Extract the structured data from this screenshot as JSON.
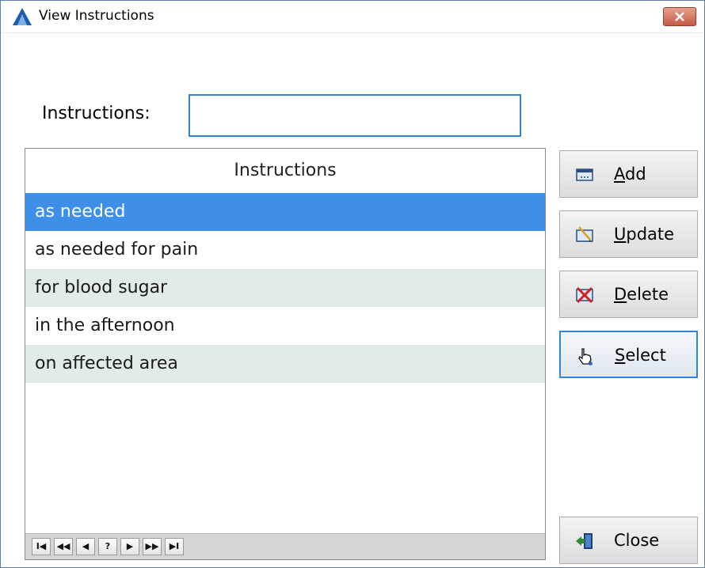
{
  "window": {
    "title": "View Instructions",
    "close_glyph": "✕"
  },
  "form": {
    "instructions_label": "Instructions:",
    "instructions_value": "",
    "instructions_placeholder": ""
  },
  "grid": {
    "header": "Instructions",
    "rows": [
      "as needed",
      "as needed for pain",
      "for blood sugar",
      "in the afternoon",
      "on affected area"
    ],
    "selected_index": 0,
    "nav": [
      "I◀",
      "◀◀",
      "◀",
      "?",
      "▶",
      "▶▶",
      "▶I"
    ]
  },
  "buttons": {
    "add": {
      "mnemonic": "A",
      "rest": "dd",
      "icon": "add-icon"
    },
    "update": {
      "mnemonic": "U",
      "rest": "pdate",
      "icon": "update-icon"
    },
    "delete": {
      "mnemonic": "D",
      "rest": "elete",
      "icon": "delete-icon"
    },
    "select": {
      "mnemonic": "S",
      "rest": "elect",
      "icon": "hand-pointer-icon"
    },
    "close": {
      "label": "Close",
      "icon": "exit-door-icon"
    }
  },
  "colors": {
    "selected_row": "#3d8fe8",
    "alt_row": "#e1ebea",
    "focus_border": "#2e86d4",
    "close_button": "#c75a45"
  }
}
